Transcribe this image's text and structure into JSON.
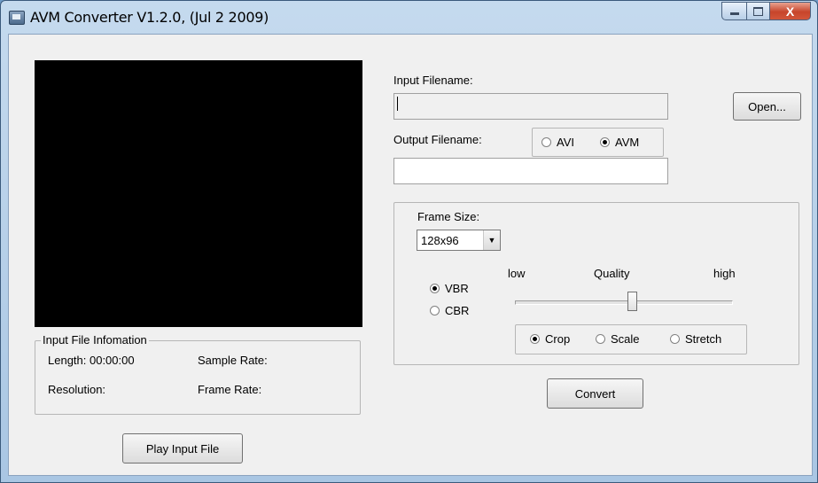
{
  "window": {
    "title": "AVM Converter V1.2.0, (Jul  2 2009)",
    "close_glyph": "X"
  },
  "input_info": {
    "group_title": "Input File Infomation",
    "length_label": "Length: 00:00:00",
    "sample_rate_label": "Sample Rate:",
    "resolution_label": "Resolution:",
    "frame_rate_label": "Frame Rate:"
  },
  "play_button": "Play Input File",
  "input_filename": {
    "label": "Input Filename:",
    "value": "",
    "open_button": "Open..."
  },
  "output_filename": {
    "label": "Output Filename:",
    "value": "",
    "formats": [
      {
        "label": "AVI",
        "checked": false
      },
      {
        "label": "AVM",
        "checked": true
      }
    ]
  },
  "settings": {
    "frame_size_label": "Frame Size:",
    "frame_size_value": "128x96",
    "rate_modes": [
      {
        "label": "VBR",
        "checked": true
      },
      {
        "label": "CBR",
        "checked": false
      }
    ],
    "quality_low": "low",
    "quality_label": "Quality",
    "quality_high": "high",
    "quality_level": 0.54,
    "scale_modes": [
      {
        "label": "Crop",
        "checked": true
      },
      {
        "label": "Scale",
        "checked": false
      },
      {
        "label": "Stretch",
        "checked": false
      }
    ]
  },
  "convert_button": "Convert"
}
